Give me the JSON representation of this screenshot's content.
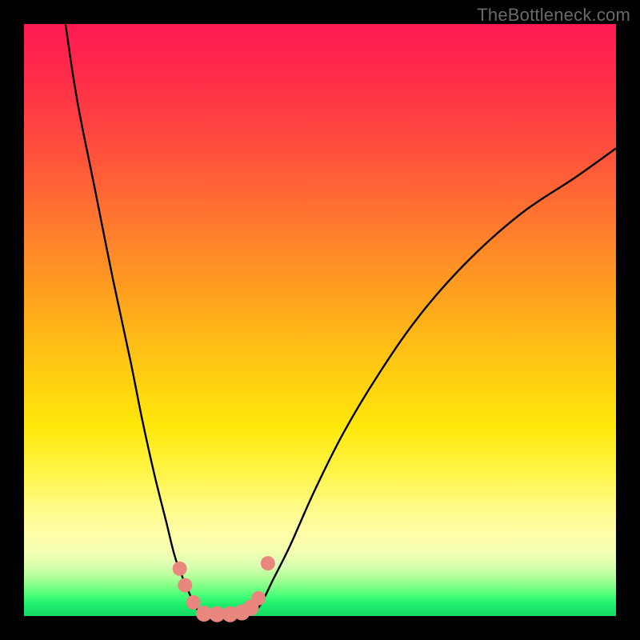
{
  "watermark": "TheBottleneck.com",
  "colors": {
    "background": "#000000",
    "curve": "#000000",
    "marker_fill": "#e9877f",
    "marker_stroke": "#d46a62"
  },
  "chart_data": {
    "type": "line",
    "title": "",
    "xlabel": "",
    "ylabel": "",
    "xlim": [
      0,
      100
    ],
    "ylim": [
      0,
      100
    ],
    "grid": false,
    "legend": false,
    "note": "Values are normalized percentages of the plot area; x = horizontal position, y = bottleneck/mismatch magnitude (0 at bottom, 100 at top).",
    "series": [
      {
        "name": "left-branch",
        "x": [
          7,
          9,
          12,
          15,
          18,
          20,
          22,
          24,
          25.5,
          27,
          28.3,
          29.2,
          29.8
        ],
        "y": [
          100,
          87,
          72,
          57,
          43,
          33,
          24,
          16,
          10,
          6,
          3,
          1.2,
          0.3
        ]
      },
      {
        "name": "right-branch",
        "x": [
          38.5,
          40,
          42,
          45,
          49,
          54,
          60,
          67,
          75,
          84,
          93,
          100
        ],
        "y": [
          0.5,
          2,
          6,
          12,
          21,
          31,
          41,
          51,
          60,
          68,
          74,
          79
        ]
      },
      {
        "name": "trough",
        "x": [
          29.8,
          31,
          33,
          35,
          37,
          38.5
        ],
        "y": [
          0.3,
          0.1,
          0.05,
          0.05,
          0.15,
          0.5
        ]
      }
    ],
    "markers": [
      {
        "series": "left-branch",
        "x": 26.3,
        "y": 8.0,
        "r": 9
      },
      {
        "series": "left-branch",
        "x": 27.2,
        "y": 5.2,
        "r": 9
      },
      {
        "series": "left-branch",
        "x": 28.6,
        "y": 2.3,
        "r": 9
      },
      {
        "series": "trough",
        "x": 30.4,
        "y": 0.4,
        "r": 10
      },
      {
        "series": "trough",
        "x": 32.6,
        "y": 0.3,
        "r": 10
      },
      {
        "series": "trough",
        "x": 34.8,
        "y": 0.3,
        "r": 10
      },
      {
        "series": "right-branch",
        "x": 36.8,
        "y": 0.6,
        "r": 10
      },
      {
        "series": "right-branch",
        "x": 38.3,
        "y": 1.4,
        "r": 10
      },
      {
        "series": "right-branch",
        "x": 39.6,
        "y": 3.0,
        "r": 9
      },
      {
        "series": "right-branch",
        "x": 41.2,
        "y": 8.9,
        "r": 9
      }
    ]
  }
}
